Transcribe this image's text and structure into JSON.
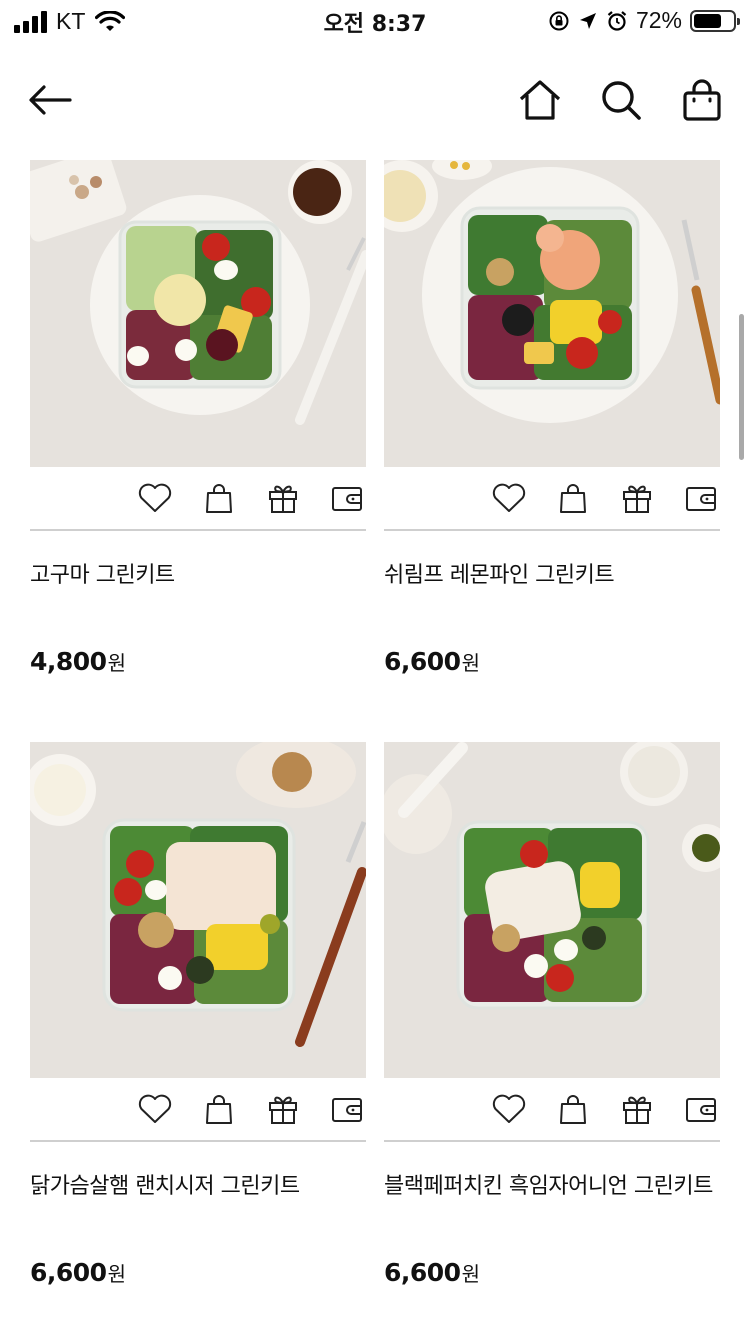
{
  "status_bar": {
    "carrier": "KT",
    "time": "오전 8:37",
    "battery_percent": "72%",
    "battery_level": 0.72
  },
  "nav": {
    "icons": [
      "back-arrow-icon",
      "home-icon",
      "search-icon",
      "shopping-bag-icon"
    ]
  },
  "products": [
    {
      "name": "고구마 그린키트",
      "price": "4,800",
      "currency": "원"
    },
    {
      "name": "쉬림프 레몬파인 그린키트",
      "price": "6,600",
      "currency": "원"
    },
    {
      "name": "닭가슴살햄 랜치시저 그린키트",
      "price": "6,600",
      "currency": "원"
    },
    {
      "name": "블랙페퍼치킨 흑임자어니언 그린키트",
      "price": "6,600",
      "currency": "원"
    }
  ],
  "card_actions": [
    "heart-icon",
    "cart-bag-icon",
    "gift-icon",
    "wallet-icon"
  ],
  "colors": {
    "background": "#ffffff",
    "divider": "#cfcfcf",
    "photo_backdrop": "#e6e2dd"
  }
}
